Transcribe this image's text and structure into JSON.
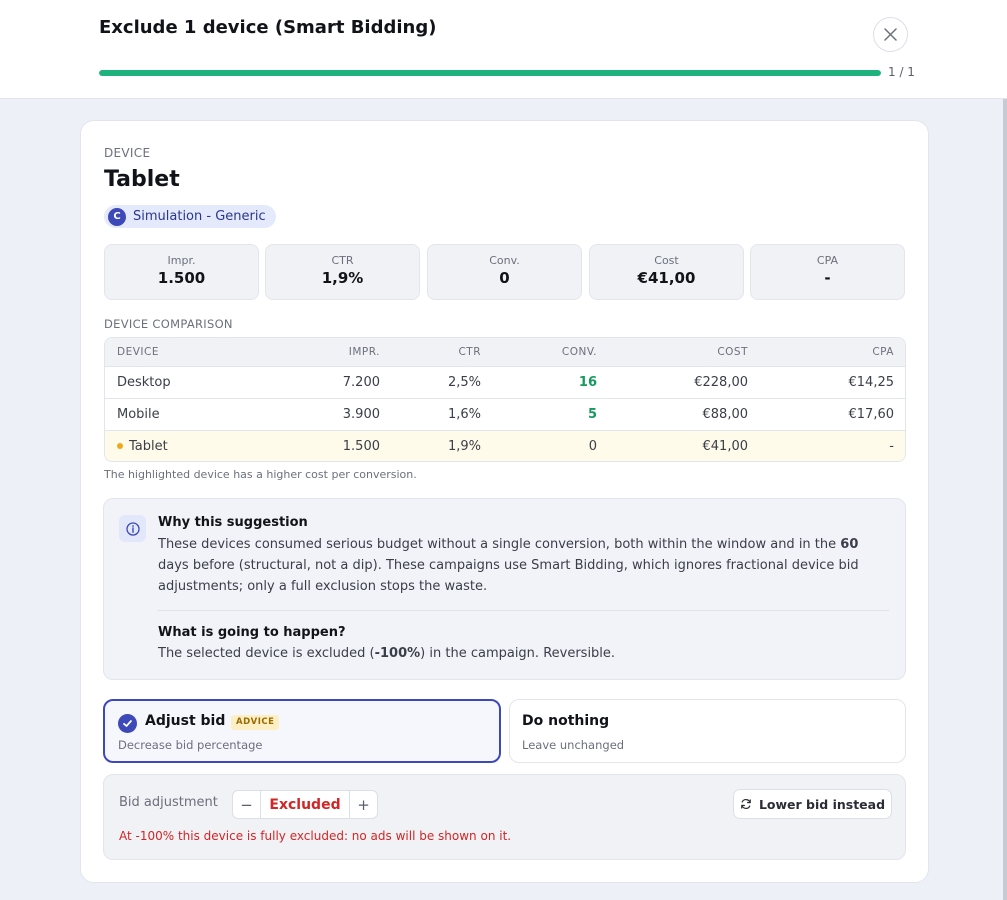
{
  "header": {
    "title": "Exclude 1 device (Smart Bidding)",
    "progress_fraction": 1.0,
    "progress_text": "1 / 1",
    "close_icon": "close-icon"
  },
  "device": {
    "section_label": "DEVICE",
    "name": "Tablet",
    "chip": {
      "letter": "C",
      "label": "Simulation - Generic"
    }
  },
  "stats": [
    {
      "label": "Impr.",
      "value": "1.500"
    },
    {
      "label": "CTR",
      "value": "1,9%"
    },
    {
      "label": "Conv.",
      "value": "0"
    },
    {
      "label": "Cost",
      "value": "€41,00"
    },
    {
      "label": "CPA",
      "value": "-"
    }
  ],
  "comparison": {
    "section_label": "DEVICE COMPARISON",
    "columns": [
      "DEVICE",
      "IMPR.",
      "CTR",
      "CONV.",
      "COST",
      "CPA"
    ],
    "rows": [
      {
        "device": "Desktop",
        "impr": "7.200",
        "ctr": "2,5%",
        "conv": "16",
        "cost": "€228,00",
        "cpa": "€14,25"
      },
      {
        "device": "Mobile",
        "impr": "3.900",
        "ctr": "1,6%",
        "conv": "5",
        "cost": "€88,00",
        "cpa": "€17,60"
      },
      {
        "device": "Tablet",
        "impr": "1.500",
        "ctr": "1,9%",
        "conv": "0",
        "cost": "€41,00",
        "cpa": "-"
      }
    ],
    "note": "The highlighted device has a higher cost per conversion."
  },
  "why": {
    "title": "Why this suggestion",
    "body_part1": "These devices consumed serious budget without a single conversion, both within the window and in the ",
    "body_bold": "60",
    "body_part2": " days before (structural, not a dip). These campaigns use Smart Bidding, which ignores fractional device bid adjustments; only a full exclusion stops the waste.",
    "happen_title": "What is going to happen?",
    "happen_part1": "The selected device is excluded (",
    "happen_bold": "-100%",
    "happen_part2": ") in the campaign. Reversible."
  },
  "options": {
    "adjust": {
      "title": "Adjust bid",
      "badge": "ADVICE",
      "subtitle": "Decrease bid percentage"
    },
    "nothing": {
      "title": "Do nothing",
      "subtitle": "Leave unchanged"
    }
  },
  "bid": {
    "label": "Bid adjustment",
    "minus": "−",
    "value": "Excluded",
    "plus": "+",
    "lower_button": "Lower bid instead",
    "warning": "At -100% this device is fully excluded: no ads will be shown on it."
  },
  "colors": {
    "accent": "#3d49b8",
    "progress": "#20b27c",
    "positive": "#169a5e",
    "danger": "#d32525",
    "highlight_row": "#fffbea",
    "warning_dot": "#f0a81b"
  }
}
